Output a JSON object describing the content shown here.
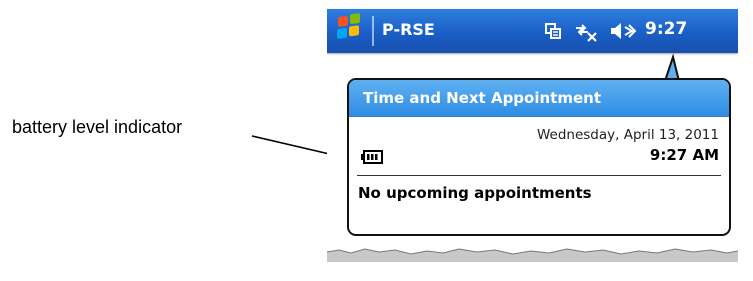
{
  "annotation": {
    "label": "battery level indicator"
  },
  "taskbar": {
    "app_title": "P-RSE",
    "clock": "9:27",
    "icons": [
      "windows-start-icon",
      "connectivity-icon",
      "sync-disconnected-icon",
      "speaker-muted-icon"
    ]
  },
  "notification": {
    "title": "Time and Next Appointment",
    "date": "Wednesday, April 13, 2011",
    "time": "9:27 AM",
    "appointments": "No upcoming appointments"
  },
  "colors": {
    "taskbar_top": "#2f7ee0",
    "taskbar_bottom": "#174fae",
    "bubble_header": "#2f8de3"
  }
}
